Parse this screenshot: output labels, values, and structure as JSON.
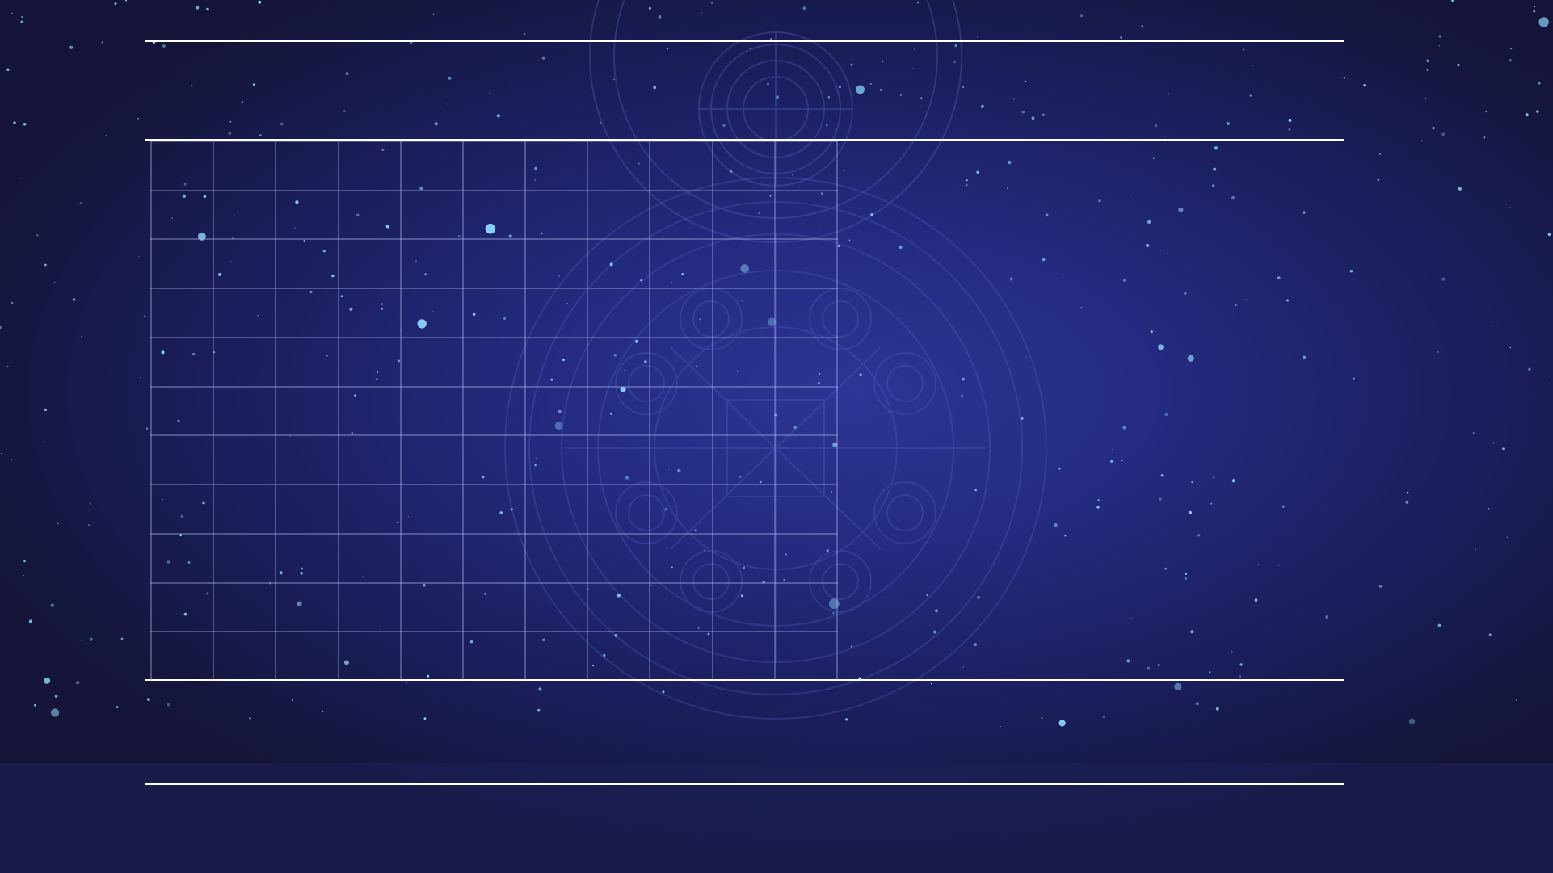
{
  "page": {
    "background_top": "#1e2574",
    "background_center": "#2d3595",
    "background_edge": "#141538",
    "line_color": "#ffffff",
    "grid_color": "#aab3e8",
    "ornament_color": "#4a56b5",
    "star_color": "#8fd9ff"
  },
  "grid": {
    "columns": 11,
    "rows": 11
  },
  "rules": {
    "count": 4
  }
}
